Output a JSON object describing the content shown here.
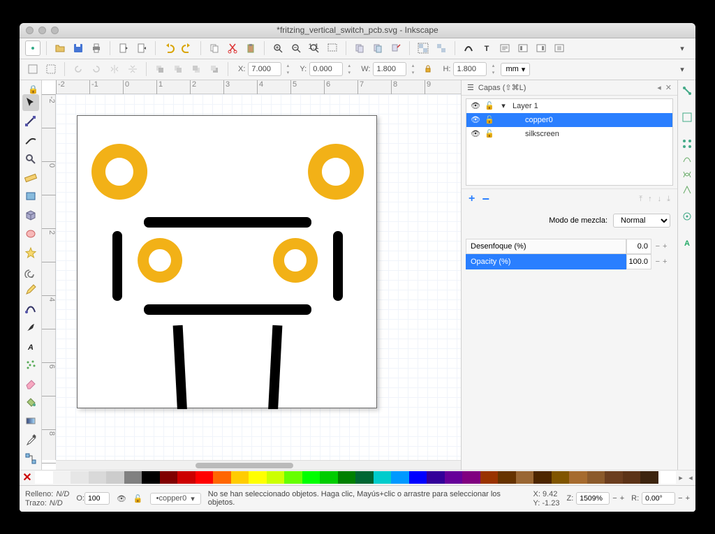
{
  "window": {
    "title": "*fritzing_vertical_switch_pcb.svg - Inkscape"
  },
  "coords": {
    "x_label": "X:",
    "x": "7.000",
    "y_label": "Y:",
    "y": "0.000",
    "w_label": "W:",
    "w": "1.800",
    "h_label": "H:",
    "h": "1.800",
    "unit": "mm"
  },
  "ruler": {
    "hticks": [
      "-2",
      "-1",
      "0",
      "1",
      "2",
      "3",
      "4",
      "5",
      "6",
      "7",
      "8",
      "9"
    ],
    "vticks": [
      "-2",
      "",
      "0",
      "",
      "2",
      "",
      "4",
      "",
      "6",
      "",
      "8",
      ""
    ]
  },
  "layers_panel": {
    "title": "Capas (⇧⌘L)",
    "rows": [
      {
        "name": "Layer 1",
        "selected": false,
        "indent": 0,
        "expand": true
      },
      {
        "name": "copper0",
        "selected": true,
        "indent": 1
      },
      {
        "name": "silkscreen",
        "selected": false,
        "indent": 1
      }
    ],
    "blend_label": "Modo de mezcla:",
    "blend_value": "Normal",
    "blur_label": "Desenfoque (%)",
    "blur_value": "0.0",
    "opacity_label": "Opacity (%)",
    "opacity_value": "100.0"
  },
  "status": {
    "fill_label": "Relleno:",
    "fill_value": "N/D",
    "stroke_label": "Trazo:",
    "stroke_value": "N/D",
    "opacity_label": "O:",
    "opacity_value": "100",
    "layer_indicator": "•copper0",
    "hint": "No se han seleccionado objetos. Haga clic, Mayús+clic o arrastre para seleccionar los objetos.",
    "cursor_x_label": "X:",
    "cursor_x": "9.42",
    "cursor_y_label": "Y:",
    "cursor_y": "-1.23",
    "zoom_label": "Z:",
    "zoom": "1509%",
    "rot_label": "R:",
    "rot": "0.00°"
  },
  "palette": [
    "#ffffff",
    "#f2f2f2",
    "#e6e6e6",
    "#d9d9d9",
    "#cccccc",
    "#808080",
    "#000000",
    "#800000",
    "#cc0000",
    "#ff0000",
    "#ff6600",
    "#ffcc00",
    "#ffff00",
    "#ccff00",
    "#66ff00",
    "#00ff00",
    "#00cc00",
    "#008000",
    "#006633",
    "#00cccc",
    "#0099ff",
    "#0000ff",
    "#330099",
    "#660099",
    "#800080",
    "#993300",
    "#663300",
    "#996633",
    "#4d2600",
    "#805500",
    "#a66b2e",
    "#8b5a2b",
    "#6b3e1f",
    "#5c3317",
    "#3d240f",
    "#ffffff"
  ]
}
